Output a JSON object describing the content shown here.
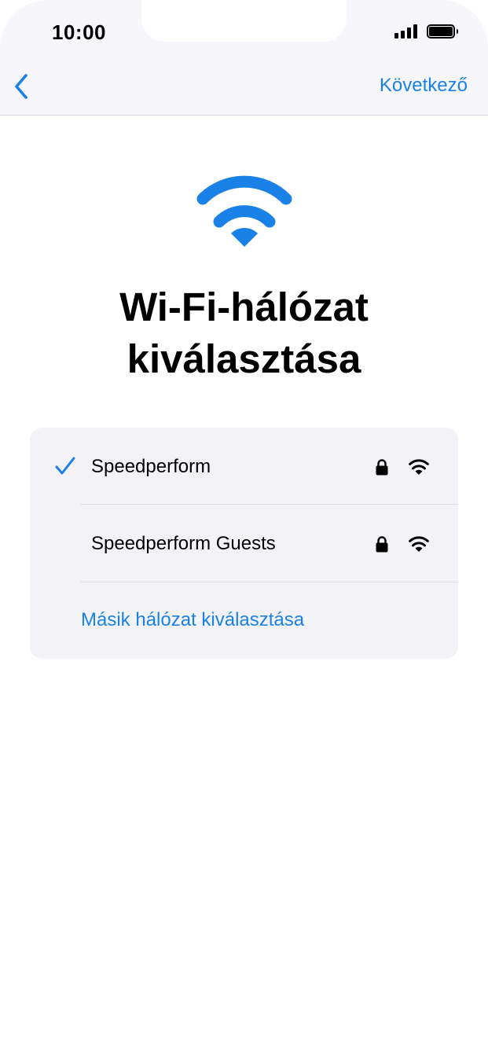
{
  "status_bar": {
    "time": "10:00"
  },
  "nav": {
    "back_icon": "chevron-left-icon",
    "next_label": "Következő"
  },
  "header": {
    "icon": "wifi-icon",
    "title_line1": "Wi-Fi-hálózat",
    "title_line2": "kiválasztása"
  },
  "networks": [
    {
      "name": "Speedperform",
      "selected": true,
      "locked": true
    },
    {
      "name": "Speedperform Guests",
      "selected": false,
      "locked": true
    }
  ],
  "other_network_label": "Másik hálózat kiválasztása",
  "colors": {
    "accent": "#1a82e6",
    "card_bg": "#f2f2f7",
    "nav_bg": "#f7f6fa"
  }
}
